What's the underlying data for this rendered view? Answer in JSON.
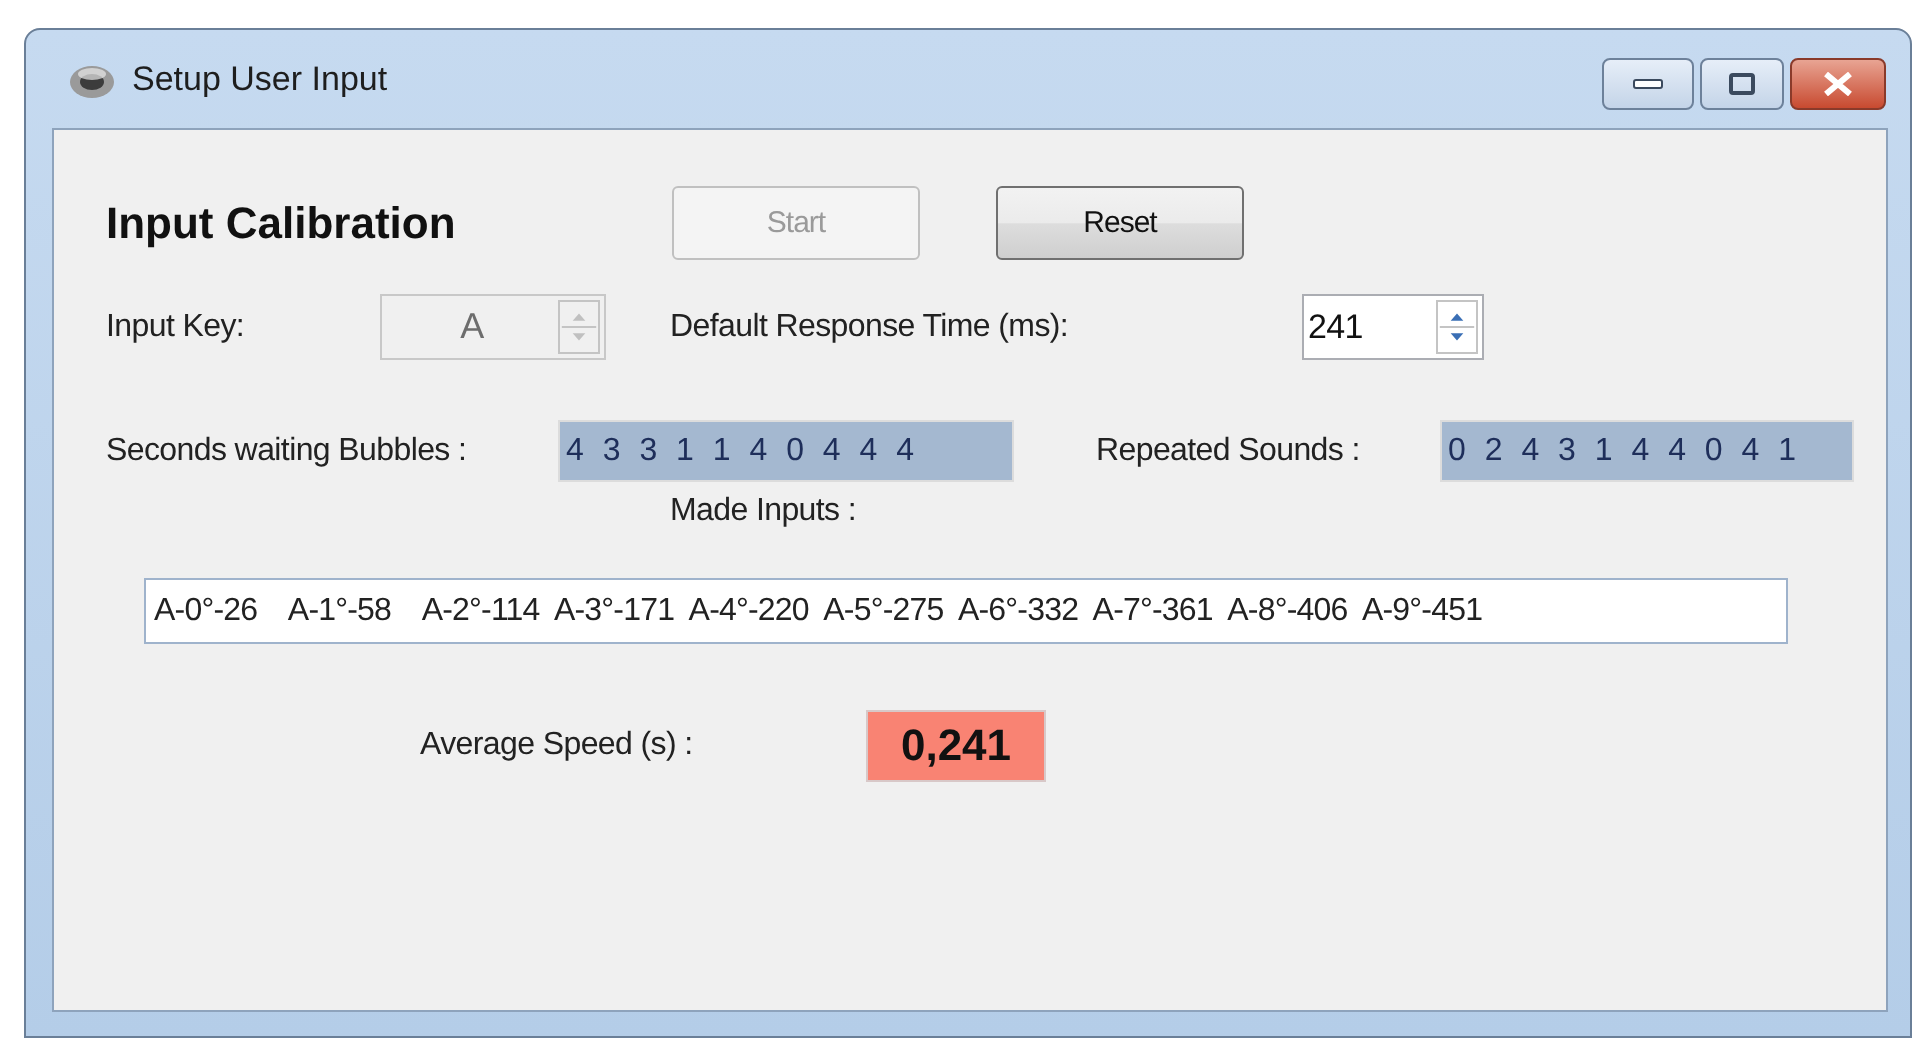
{
  "window": {
    "title": "Setup User Input"
  },
  "heading": "Input Calibration",
  "buttons": [
    {
      "label": "Start",
      "disabled": true
    },
    {
      "label": "Reset",
      "disabled": false
    }
  ],
  "input_key": {
    "label": "Input Key:",
    "value": "A",
    "disabled": true
  },
  "response_time": {
    "label": "Default Response Time (ms):",
    "value": "241",
    "disabled": false
  },
  "seconds_waiting": {
    "label": "Seconds waiting Bubbles :",
    "value": "4 3 3 1 1 4 0 4 4 4"
  },
  "repeated_sounds": {
    "label": "Repeated Sounds :",
    "value": "0 2 4 3 1 4 4 0 4 1"
  },
  "made_inputs": {
    "label": "Made Inputs :",
    "value": "A-0°-26    A-1°-58    A-2°-114  A-3°-171  A-4°-220  A-5°-275  A-6°-332  A-7°-361  A-8°-406  A-9°-451"
  },
  "average_speed": {
    "label": "Average Speed (s) :",
    "value": "0,241"
  }
}
